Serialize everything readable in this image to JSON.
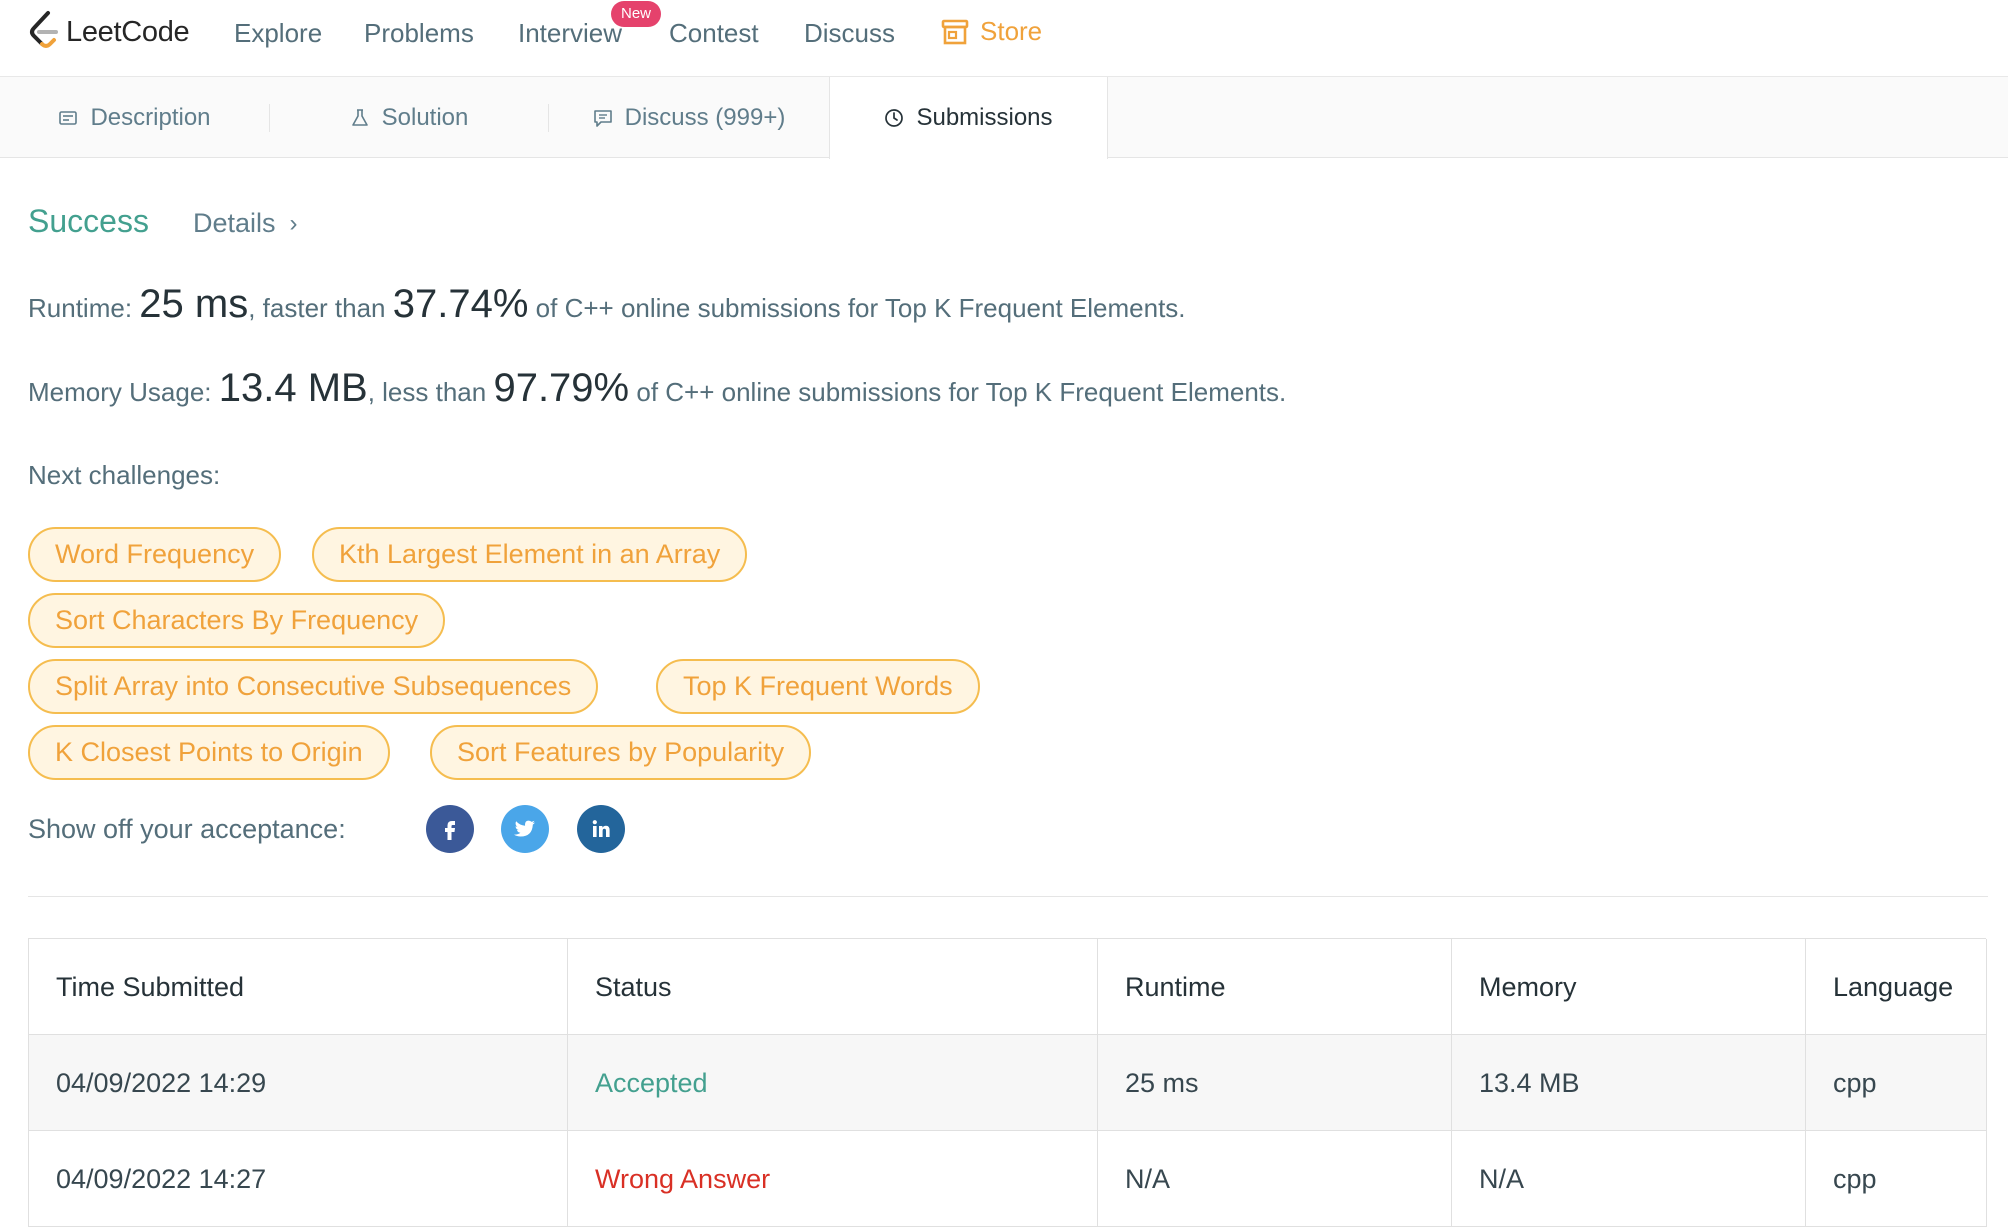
{
  "nav": {
    "logo_text": "LeetCode",
    "items": [
      "Explore",
      "Problems",
      "Interview",
      "Contest",
      "Discuss"
    ],
    "badge": "New",
    "store": "Store",
    "store_color": "#f0a23b"
  },
  "tabs": [
    {
      "label": "Description",
      "icon": "description-icon"
    },
    {
      "label": "Solution",
      "icon": "flask-icon"
    },
    {
      "label": "Discuss (999+)",
      "icon": "comment-icon"
    },
    {
      "label": "Submissions",
      "icon": "clock-icon",
      "active": true
    }
  ],
  "result": {
    "status": "Success",
    "status_color": "#43a08f",
    "details": "Details",
    "runtime": {
      "prefix": "Runtime:",
      "value": "25 ms",
      "mid": ", faster than",
      "percent": "37.74%",
      "suffix": "of C++ online submissions for Top K Frequent Elements."
    },
    "memory": {
      "prefix": "Memory Usage:",
      "value": "13.4 MB",
      "mid": ", less than",
      "percent": "97.79%",
      "suffix": "of C++ online submissions for Top K Frequent Elements."
    },
    "next_label": "Next challenges:",
    "challenges": [
      "Word Frequency",
      "Kth Largest Element in an Array",
      "Sort Characters By Frequency",
      "Split Array into Consecutive Subsequences",
      "Top K Frequent Words",
      "K Closest Points to Origin",
      "Sort Features by Popularity"
    ],
    "share_label": "Show off your acceptance:",
    "share": [
      {
        "name": "facebook-icon",
        "color": "#3b5998"
      },
      {
        "name": "twitter-icon",
        "color": "#4aa6e9"
      },
      {
        "name": "linkedin-icon",
        "color": "#23659b"
      }
    ]
  },
  "table": {
    "headers": [
      "Time Submitted",
      "Status",
      "Runtime",
      "Memory",
      "Language"
    ],
    "rows": [
      {
        "time": "04/09/2022 14:29",
        "status": "Accepted",
        "status_color": "#43a08f",
        "runtime": "25 ms",
        "memory": "13.4 MB",
        "language": "cpp"
      },
      {
        "time": "04/09/2022 14:27",
        "status": "Wrong Answer",
        "status_color": "#d93025",
        "runtime": "N/A",
        "memory": "N/A",
        "language": "cpp"
      }
    ]
  }
}
